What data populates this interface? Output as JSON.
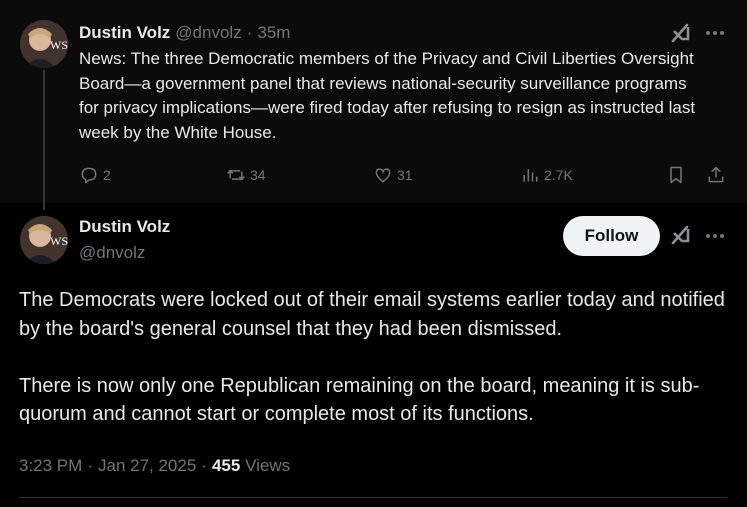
{
  "parent_tweet": {
    "author_name": "Dustin Volz",
    "handle": "@dnvolz",
    "separator": "·",
    "time_ago": "35m",
    "text": "News: The three Democratic members of the Privacy and Civil Liberties Oversight Board—a government panel that reviews national-security surveillance programs for privacy implications—were fired today after refusing to resign as instructed last week by the White House.",
    "avatar_text": "WSJ",
    "actions": {
      "replies": "2",
      "reposts": "34",
      "likes": "31",
      "views": "2.7K"
    }
  },
  "focused_tweet": {
    "author_name": "Dustin Volz",
    "handle": "@dnvolz",
    "avatar_text": "WSJ",
    "follow_label": "Follow",
    "paragraphs": [
      "The Democrats were locked out of their email systems earlier today and notified by the board's general counsel that they had been dismissed.",
      "There is now only one Republican remaining on the board, meaning it is sub-quorum and cannot start or complete most of its functions."
    ],
    "time": "3:23 PM",
    "date": "Jan 27, 2025",
    "separator": "·",
    "view_count": "455",
    "views_label": "Views"
  },
  "icons": [
    "grok-icon",
    "more-icon",
    "reply-icon",
    "repost-icon",
    "like-icon",
    "views-icon",
    "bookmark-icon",
    "share-icon"
  ],
  "colors": {
    "background": "#000000",
    "parent_background": "#0b0b0b",
    "text": "#e7e9ea",
    "muted": "#71767b",
    "follow_bg": "#eff3f4"
  }
}
